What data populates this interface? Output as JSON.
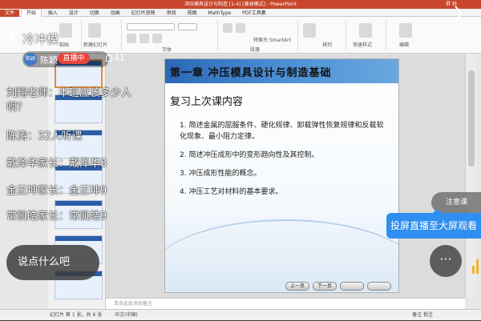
{
  "ppt": {
    "window_title": "冲压模具设计与制造 [1-4] [兼容模式] - PowerPoint",
    "user": "昇 轩",
    "tabs": [
      "文件",
      "开始",
      "插入",
      "设计",
      "切换",
      "动画",
      "幻灯片放映",
      "审阅",
      "视图",
      "MathType",
      "PDF工具集"
    ],
    "ribbon_labels": [
      "粘贴",
      "新建幻灯片",
      "字体",
      "段落",
      "排列",
      "快速样式",
      "编辑"
    ],
    "convert_smartart": "转换为 SmartArt",
    "notes_placeholder": "单击此处添加备注",
    "status_left": "幻灯片 第 1 张，共 6 张",
    "status_lang": "中文(中国)",
    "zoom_label": "备注   批注"
  },
  "slide": {
    "title": "第一章  冲压模具设计与制造基础",
    "subtitle": "复习上次课内容",
    "items": [
      "1. 简述金属的屈服条件、硬化规律、卸载弹性恢复规律和反载软化现象、最小阻力定律。",
      "2. 简述冲压成形中的变形趋向性及其控制。",
      "3. 冲压成形性能的概念。",
      "4. 冲压工艺对材料的基本要求。"
    ],
    "nav": [
      "上一页",
      "下一页",
      "",
      "",
      ""
    ]
  },
  "live": {
    "room_title": "冷冲模",
    "host_avatar_text": "陈颖",
    "host_name": "陈颖",
    "live_badge": "直播中",
    "viewers": "41",
    "comments": [
      {
        "text": "刘翔老师：本班应该多少人啊？"
      },
      {
        "text": "陈涛：32人听课"
      },
      {
        "text": "戴泽华家长：戴泽华8"
      },
      {
        "text": "金正坤家长：金正坤9"
      },
      {
        "text": "常凯皓家长：常凯皓9"
      }
    ],
    "say_placeholder": "说点什么吧",
    "cast_tip": "投屏直播至大屏观看",
    "side_bubble": "注意课",
    "more_label": "···"
  }
}
